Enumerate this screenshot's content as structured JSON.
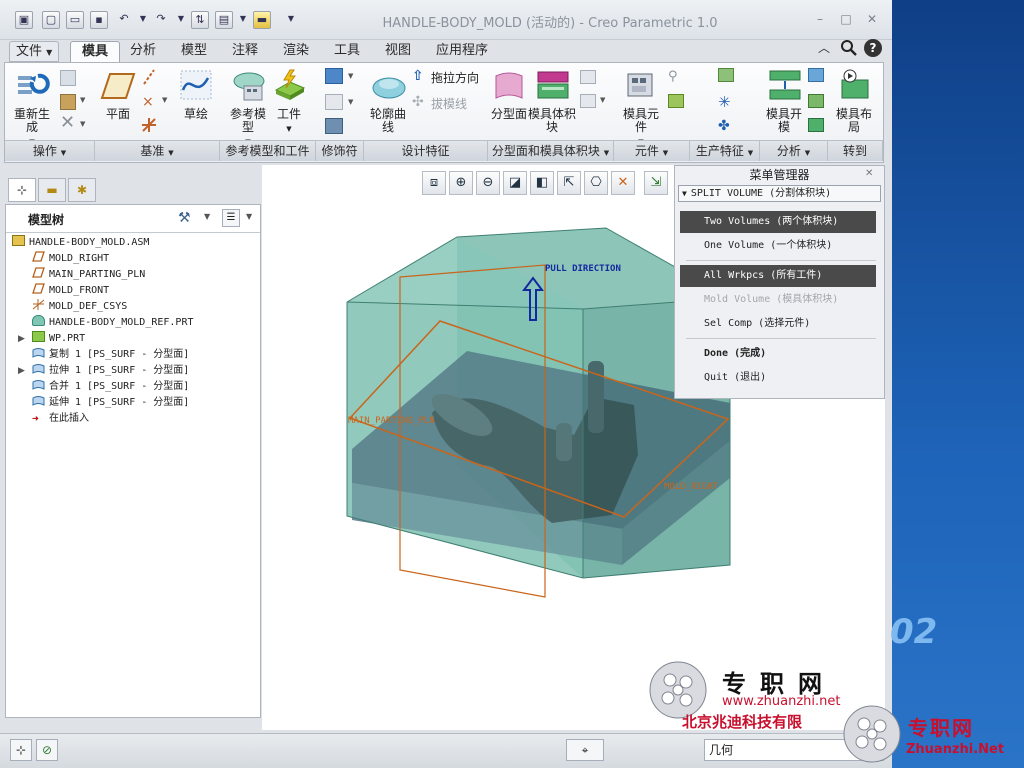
{
  "window": {
    "title": "HANDLE-BODY_MOLD (活动的) - Creo Parametric 1.0",
    "controls": [
      "–",
      "□",
      "✕"
    ]
  },
  "tabs": [
    {
      "label": "文件",
      "state": "file-menu"
    },
    {
      "label": "模具",
      "state": "active"
    },
    {
      "label": "分析"
    },
    {
      "label": "模型"
    },
    {
      "label": "注释"
    },
    {
      "label": "渲染"
    },
    {
      "label": "工具"
    },
    {
      "label": "视图"
    },
    {
      "label": "应用程序"
    }
  ],
  "ribbon": {
    "buttons": {
      "regenerate": "重新生成",
      "plane": "平面",
      "sketch": "草绘",
      "ref_model": "参考模型",
      "workpiece": "工件",
      "drag_direction": "拖拉方向",
      "draft_line": "拔模线",
      "silhouette": "轮廓曲线",
      "parting_surface": "分型面",
      "mold_volume": "模具体积块",
      "mold_component": "模具元件",
      "mold_open": "模具开模",
      "mold_layout": "模具布局"
    },
    "groups": [
      {
        "label": "操作",
        "dropdown": true
      },
      {
        "label": "基准",
        "dropdown": true
      },
      {
        "label": "参考模型和工件",
        "dropdown": false
      },
      {
        "label": "修饰符",
        "dropdown": false
      },
      {
        "label": "设计特征",
        "dropdown": false
      },
      {
        "label": "分型面和模具体积块",
        "dropdown": true
      },
      {
        "label": "元件",
        "dropdown": true
      },
      {
        "label": "生产特征",
        "dropdown": true
      },
      {
        "label": "分析",
        "dropdown": true
      },
      {
        "label": "转到",
        "dropdown": false
      }
    ]
  },
  "model_tree": {
    "title": "模型树",
    "items": [
      {
        "label": "HANDLE-BODY_MOLD.ASM",
        "icon": "assembly-icon",
        "expand": false
      },
      {
        "label": "MOLD_RIGHT",
        "icon": "datum-plane-icon",
        "expand": false
      },
      {
        "label": "MAIN_PARTING_PLN",
        "icon": "datum-plane-icon",
        "expand": false
      },
      {
        "label": "MOLD_FRONT",
        "icon": "datum-plane-icon",
        "expand": false
      },
      {
        "label": "MOLD_DEF_CSYS",
        "icon": "csys-icon",
        "expand": false
      },
      {
        "label": "HANDLE-BODY_MOLD_REF.PRT",
        "icon": "part-icon",
        "expand": false
      },
      {
        "label": "WP.PRT",
        "icon": "workpiece-icon",
        "expand": true
      },
      {
        "label": "复制 1 [PS_SURF - 分型面]",
        "icon": "surface-icon",
        "expand": false
      },
      {
        "label": "拉伸 1 [PS_SURF - 分型面]",
        "icon": "surface-icon",
        "expand": true
      },
      {
        "label": "合并 1 [PS_SURF - 分型面]",
        "icon": "surface-icon",
        "expand": false
      },
      {
        "label": "延伸 1 [PS_SURF - 分型面]",
        "icon": "surface-icon",
        "expand": false
      },
      {
        "label": "在此插入",
        "icon": "insert-arrow-icon",
        "expand": false
      }
    ]
  },
  "viewport": {
    "annotations": {
      "pull_direction": "PULL DIRECTION",
      "main_parting": "MAIN_PARTING_PLN",
      "mold_right": "MOLD_RIGHT"
    }
  },
  "menu_manager": {
    "title": "菜单管理器",
    "section": "SPLIT VOLUME (分割体积块)",
    "items": [
      {
        "label": "Two Volumes (两个体积块)",
        "state": "selected"
      },
      {
        "label": "One Volume (一个体积块)",
        "state": "normal"
      },
      {
        "label": "All Wrkpcs (所有工件)",
        "state": "selected"
      },
      {
        "label": "Mold Volume (模具体积块)",
        "state": "disabled"
      },
      {
        "label": "Sel Comp (选择元件)",
        "state": "normal"
      },
      {
        "label": "Done (完成)",
        "state": "bold"
      },
      {
        "label": "Quit (退出)",
        "state": "normal"
      }
    ]
  },
  "status_bar": {
    "filter": "几何"
  },
  "watermark": {
    "site_cn": "专职网",
    "url": "www.zhuanzhi.net",
    "company": "北京兆迪科技有限",
    "site_cn2": "专职网",
    "url2": "Zhuanzhi.Net",
    "desktop_digits": "02"
  },
  "colors": {
    "accent_blue": "#1b5aa8",
    "mold_green": "#5fa89a",
    "menu_selected": "#4a4a4a",
    "annotation_orange": "#c9651b",
    "annotation_blue": "#1428a0",
    "watermark_red": "#c8102e"
  }
}
